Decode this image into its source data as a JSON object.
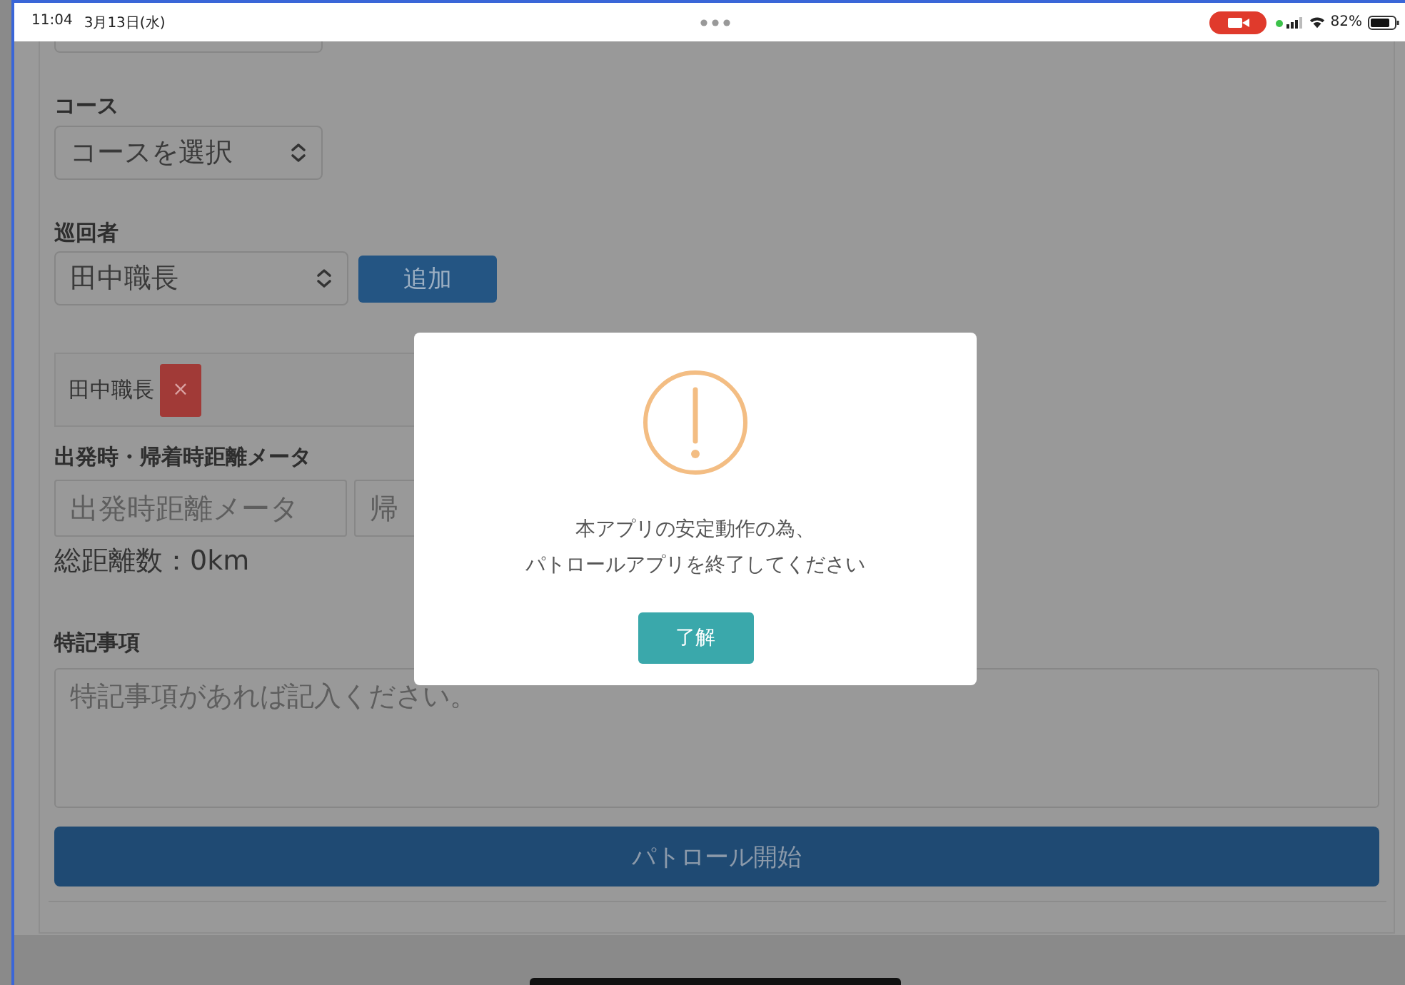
{
  "status_bar": {
    "time": "11:04",
    "date": "3月13日(水)",
    "battery": "82%"
  },
  "form": {
    "course": {
      "label": "コース",
      "value": "コースを選択"
    },
    "patroller": {
      "label": "巡回者",
      "value": "田中職長",
      "add_button": "追加",
      "members": [
        {
          "name": "田中職長",
          "remove": "×"
        }
      ]
    },
    "meter": {
      "label": "出発時・帰着時距離メータ",
      "inputs": [
        {
          "placeholder": "出発時距離メータ"
        },
        {
          "placeholder": "帰"
        }
      ],
      "total": "総距離数：0km"
    },
    "notes": {
      "label": "特記事項",
      "placeholder": "特記事項があれば記入ください。"
    },
    "submit": "パトロール開始"
  },
  "dialog": {
    "message_lines": [
      "本アプリの安定動作の為、",
      "パトロールアプリを終了してください"
    ],
    "ok_button": "了解"
  }
}
